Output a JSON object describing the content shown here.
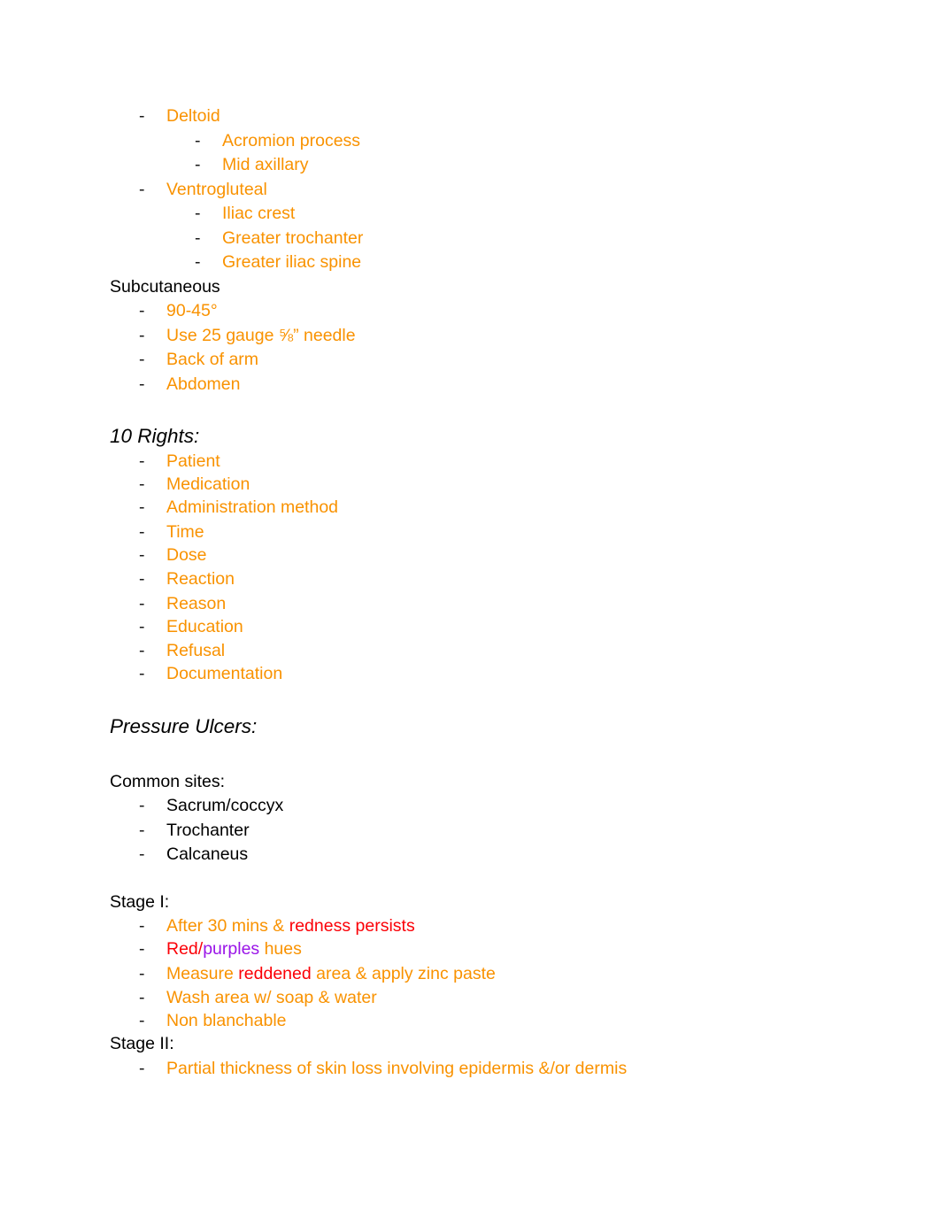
{
  "document": {
    "sections": [
      {
        "id": "im-sites",
        "items": [
          {
            "level": 1,
            "color": "orange",
            "text": "Deltoid"
          },
          {
            "level": 2,
            "color": "orange",
            "text": "Acromion process"
          },
          {
            "level": 2,
            "color": "orange",
            "text": "Mid axillary"
          },
          {
            "level": 1,
            "color": "orange",
            "text": "Ventrogluteal"
          },
          {
            "level": 2,
            "color": "orange",
            "text": "Iliac crest"
          },
          {
            "level": 2,
            "color": "orange",
            "text": "Greater trochanter"
          },
          {
            "level": 2,
            "color": "orange",
            "text": "Greater iliac spine"
          }
        ]
      },
      {
        "id": "subcutaneous",
        "label": "Subcutaneous",
        "items": [
          {
            "level": 1,
            "color": "orange",
            "text": "90-45°"
          },
          {
            "level": 1,
            "color": "orange",
            "text": "Use 25 gauge ⅝” needle"
          },
          {
            "level": 1,
            "color": "orange",
            "text": "Back of arm"
          },
          {
            "level": 1,
            "color": "orange",
            "text": "Abdomen"
          }
        ]
      },
      {
        "id": "ten-rights",
        "heading": "10 Rights:",
        "items": [
          {
            "level": 1,
            "color": "orange",
            "text": "Patient"
          },
          {
            "level": 1,
            "color": "orange",
            "text": "Medication"
          },
          {
            "level": 1,
            "color": "orange",
            "text": "Administration method"
          },
          {
            "level": 1,
            "color": "orange",
            "text": "Time"
          },
          {
            "level": 1,
            "color": "orange",
            "text": "Dose"
          },
          {
            "level": 1,
            "color": "orange",
            "text": "Reaction"
          },
          {
            "level": 1,
            "color": "orange",
            "text": "Reason"
          },
          {
            "level": 1,
            "color": "orange",
            "text": "Education"
          },
          {
            "level": 1,
            "color": "orange",
            "text": "Refusal"
          },
          {
            "level": 1,
            "color": "orange",
            "text": "Documentation"
          }
        ]
      },
      {
        "id": "pressure-ulcers",
        "heading": "Pressure Ulcers:",
        "common_sites_label": "Common sites:",
        "common_sites": [
          {
            "level": 1,
            "color": "black",
            "text": "Sacrum/coccyx"
          },
          {
            "level": 1,
            "color": "black",
            "text": "Trochanter"
          },
          {
            "level": 1,
            "color": "black",
            "text": "Calcaneus"
          }
        ],
        "stage_one_label": "Stage I:",
        "stage_one": [
          {
            "level": 1,
            "runs": [
              {
                "color": "orange",
                "text": "After 30 mins & "
              },
              {
                "color": "red",
                "text": "redness persists"
              }
            ]
          },
          {
            "level": 1,
            "runs": [
              {
                "color": "red",
                "text": "Red/"
              },
              {
                "color": "purple",
                "text": "purples"
              },
              {
                "color": "orange",
                "text": " hues"
              }
            ]
          },
          {
            "level": 1,
            "runs": [
              {
                "color": "orange",
                "text": "Measure "
              },
              {
                "color": "red",
                "text": "reddened"
              },
              {
                "color": "orange",
                "text": " area & apply zinc paste"
              }
            ]
          },
          {
            "level": 1,
            "runs": [
              {
                "color": "orange",
                "text": "Wash area w/ soap & water"
              }
            ]
          },
          {
            "level": 1,
            "runs": [
              {
                "color": "orange",
                "text": "Non blanchable"
              }
            ]
          }
        ],
        "stage_two_label": "Stage II:",
        "stage_two": [
          {
            "level": 1,
            "color": "orange",
            "text": "Partial thickness of skin loss involving epidermis &/or dermis"
          }
        ]
      }
    ],
    "bullet_glyph": "-",
    "colors": {
      "orange": "#f99200",
      "red": "#fb0007",
      "purple": "#9a15e8",
      "black": "#000000"
    }
  }
}
